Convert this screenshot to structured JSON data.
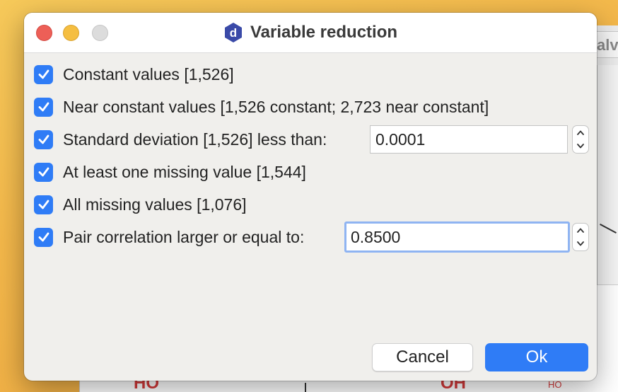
{
  "background_app": {
    "tab_partial": "alv",
    "mol_labels": [
      "HO",
      "OH",
      "HO"
    ]
  },
  "dialog": {
    "title": "Variable reduction",
    "app_icon_letter": "d",
    "window_controls": [
      "close",
      "minimize",
      "zoom"
    ],
    "options": [
      {
        "label": "Constant values [1,526]",
        "checked": true
      },
      {
        "label": "Near constant values [1,526 constant; 2,723 near constant]",
        "checked": true
      },
      {
        "label": "Standard deviation [1,526] less than:",
        "checked": true
      },
      {
        "label": "At least one missing value [1,544]",
        "checked": true
      },
      {
        "label": "All missing values [1,076]",
        "checked": true
      },
      {
        "label": "Pair correlation larger or equal to:",
        "checked": true
      }
    ],
    "sd_threshold": "0.0001",
    "pair_corr_threshold": "0.8500",
    "buttons": {
      "cancel": "Cancel",
      "ok": "Ok"
    },
    "colors": {
      "accent": "#2f7cf6",
      "close": "#ed5f57",
      "minimize": "#f5be41",
      "zoom": "#dcdcdc"
    }
  }
}
